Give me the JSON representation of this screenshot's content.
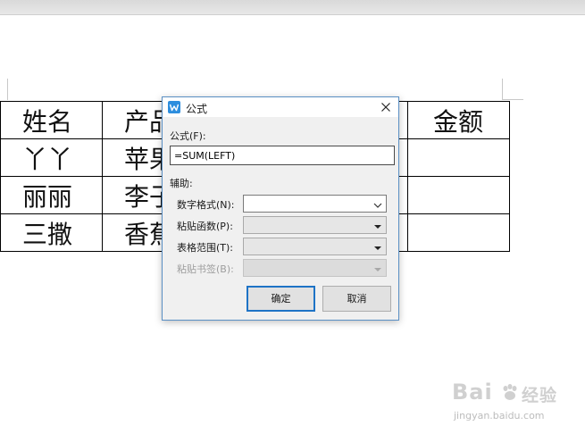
{
  "table": {
    "rows": [
      [
        "姓名",
        "产品",
        "",
        "",
        "金额"
      ],
      [
        "丫丫",
        "苹果",
        "",
        "",
        ""
      ],
      [
        "丽丽",
        "李子",
        "",
        "",
        ""
      ],
      [
        "三撒",
        "香蕉",
        "",
        "",
        ""
      ]
    ]
  },
  "dialog": {
    "title": "公式",
    "formula_label": "公式(F):",
    "formula_value": "=SUM(LEFT)",
    "aux_label": "辅助:",
    "number_format_label": "数字格式(N):",
    "number_format_value": "",
    "paste_function_label": "粘贴函数(P):",
    "paste_function_value": "",
    "table_range_label": "表格范围(T):",
    "table_range_value": "",
    "paste_bookmark_label": "粘贴书签(B):",
    "paste_bookmark_value": "",
    "ok_label": "确定",
    "cancel_label": "取消"
  },
  "icons": {
    "app": "wps-writer-icon",
    "close": "close-icon",
    "dropdown": "chevron-down-icon"
  },
  "colors": {
    "accent": "#2e8ede",
    "dialog_border": "#5a8fc4",
    "primary_button_border": "#1e73c6"
  },
  "watermark": {
    "brand": "Bai",
    "brand_suffix": "经验",
    "url": "jingyan.baidu.com"
  }
}
